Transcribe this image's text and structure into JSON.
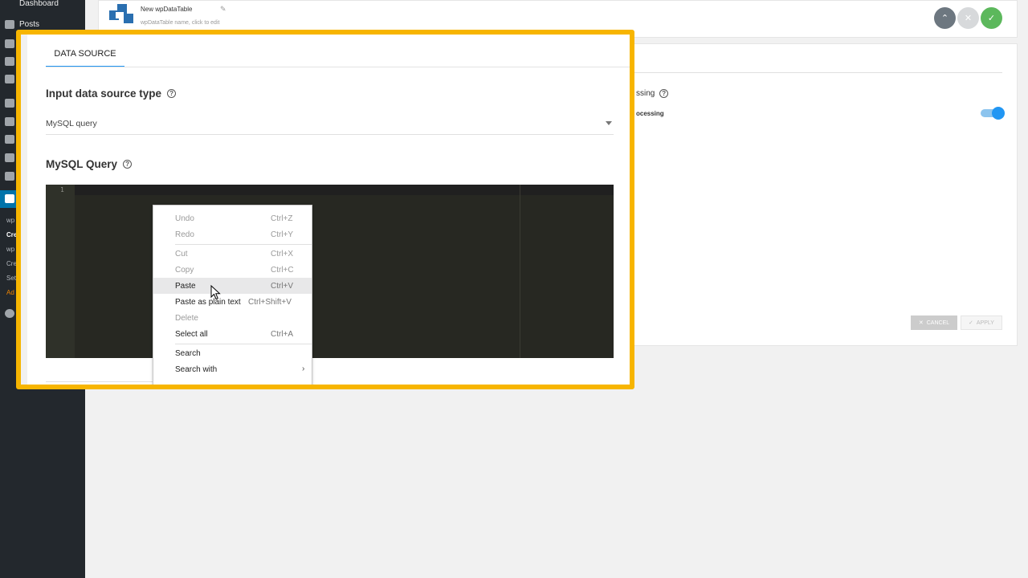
{
  "sidebar": {
    "dashboard_label": "Dashboard",
    "posts_label": "Posts",
    "wpdatatables_items": [
      "wp",
      "Cre",
      "wp",
      "Cre",
      "Set",
      "Ad"
    ]
  },
  "header": {
    "table_name": "New wpDataTable",
    "table_name_hint": "wpDataTable name, click to edit"
  },
  "settings": {
    "processing_title": "ssing",
    "processing_label": "ocessing",
    "cancel_label": "CANCEL",
    "apply_label": "APPLY",
    "toggle_on": true
  },
  "modal": {
    "tab_label": "DATA SOURCE",
    "source_type_title": "Input data source type",
    "source_type_value": "MySQL query",
    "query_title": "MySQL Query",
    "editor_line_number": "1"
  },
  "context_menu": {
    "items": [
      {
        "label": "Undo",
        "shortcut": "Ctrl+Z",
        "enabled": false
      },
      {
        "label": "Redo",
        "shortcut": "Ctrl+Y",
        "enabled": false
      },
      {
        "label": "Cut",
        "shortcut": "Ctrl+X",
        "enabled": false
      },
      {
        "label": "Copy",
        "shortcut": "Ctrl+C",
        "enabled": false
      },
      {
        "label": "Paste",
        "shortcut": "Ctrl+V",
        "enabled": true
      },
      {
        "label": "Paste as plain text",
        "shortcut": "Ctrl+Shift+V",
        "enabled": true
      },
      {
        "label": "Delete",
        "shortcut": "",
        "enabled": false
      },
      {
        "label": "Select all",
        "shortcut": "Ctrl+A",
        "enabled": true
      },
      {
        "label": "Search",
        "shortcut": "",
        "enabled": true
      },
      {
        "label": "Search with",
        "shortcut": "",
        "enabled": true
      }
    ]
  },
  "colors": {
    "highlight_border": "#f7b500",
    "accent": "#2196f3",
    "sidebar_bg": "#23282d",
    "editor_bg": "#272822"
  }
}
